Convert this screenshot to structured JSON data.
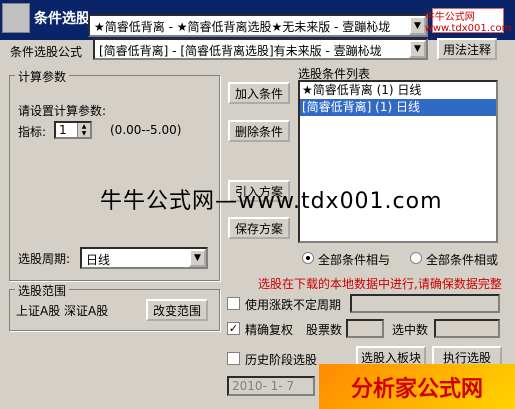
{
  "window": {
    "title": "条件选股"
  },
  "formula": {
    "top_value": "★简睿低背离 - ★简睿低背离选股★无未来版 - 壹蹦杺垅",
    "label": "条件选股公式",
    "value": "[简睿低背离] - [简睿低背离选股]有未来版 - 壹蹦杺垅",
    "usage_button": "用法注释"
  },
  "params": {
    "group_title": "计算参数",
    "prompt": "请设置计算参数:",
    "indicator_label": "指标:",
    "indicator_value": "1",
    "range_text": "(0.00--5.00)"
  },
  "period": {
    "label": "选股周期:",
    "value": "日线"
  },
  "range": {
    "group_title": "选股范围",
    "value": "上证A股 深证A股",
    "change_button": "改变范围"
  },
  "actions": {
    "add": "加入条件",
    "remove": "删除条件",
    "import": "引入方案",
    "save": "保存方案"
  },
  "conditions": {
    "title": "选股条件列表",
    "items": [
      {
        "text": "★简睿低背离 (1) 日线",
        "selected": false
      },
      {
        "text": "[简睿低背离] (1) 日线",
        "selected": true
      }
    ]
  },
  "logic": {
    "and_label": "全部条件相与",
    "or_label": "全部条件相或",
    "selected": "and"
  },
  "notice": "选股在下载的本地数据中进行,请确保数据完整",
  "options": {
    "uncertain_period": {
      "label": "使用涨跌不定周期",
      "checked": false
    },
    "precise_adjust": {
      "label": "精确复权",
      "checked": true
    },
    "stock_count_label": "股票数",
    "selected_count_label": "选中数",
    "history_stage": {
      "label": "历史阶段选股",
      "checked": false
    },
    "date_value": "2010- 1- 7"
  },
  "bottom_buttons": {
    "add_to_block": "选股入板块",
    "execute": "执行选股"
  },
  "watermarks": {
    "center": "牛牛公式网—www.tdx001.com",
    "stamp": "牛牛公式网 www.tdx001.com",
    "logo": "分析家公式网"
  },
  "colors": {
    "title_bar": "#0a246a",
    "selection": "#316ac5",
    "notice": "#cc0000"
  }
}
